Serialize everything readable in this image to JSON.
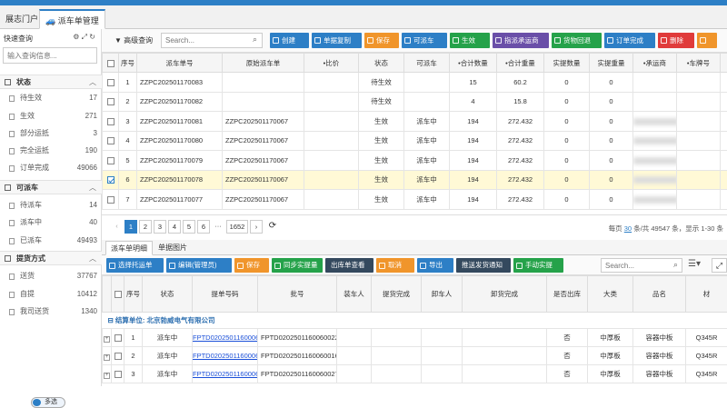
{
  "tabs": [
    {
      "label": "展志门户"
    },
    {
      "label": "派车单管理"
    }
  ],
  "sidebar": {
    "title": "快速查询",
    "search_placeholder": "输入查询信息...",
    "groups": [
      {
        "label": "状态",
        "items": [
          {
            "label": "待生效",
            "count": "17"
          },
          {
            "label": "生效",
            "count": "271"
          },
          {
            "label": "部分运抵",
            "count": "3"
          },
          {
            "label": "完全运抵",
            "count": "190"
          },
          {
            "label": "订单完成",
            "count": "49066"
          }
        ]
      },
      {
        "label": "可派车",
        "items": [
          {
            "label": "待派车",
            "count": "14"
          },
          {
            "label": "派车中",
            "count": "40"
          },
          {
            "label": "已派车",
            "count": "49493"
          }
        ]
      },
      {
        "label": "提货方式",
        "items": [
          {
            "label": "送货",
            "count": "37767"
          },
          {
            "label": "自提",
            "count": "10412"
          },
          {
            "label": "我司送货",
            "count": "1340"
          }
        ]
      }
    ],
    "toggle_label": "多选"
  },
  "toolbar": {
    "adv_query": "高级查询",
    "search_placeholder": "Search...",
    "buttons": [
      {
        "label": "创建",
        "color": "#2d7fc6"
      },
      {
        "label": "单据复制",
        "color": "#2d7fc6"
      },
      {
        "label": "保存",
        "color": "#f0952b"
      },
      {
        "label": "可派车",
        "color": "#2d7fc6"
      },
      {
        "label": "生效",
        "color": "#25a24a"
      },
      {
        "label": "指派承运商",
        "color": "#6a4fa8"
      },
      {
        "label": "货物回退",
        "color": "#25a24a"
      },
      {
        "label": "订单完成",
        "color": "#2d7fc6"
      },
      {
        "label": "删除",
        "color": "#e03b3b"
      },
      {
        "label": "",
        "color": "#f0952b"
      }
    ]
  },
  "grid": {
    "columns": [
      "",
      "序号",
      "派车单号",
      "原始派车单",
      "•比价",
      "状态",
      "可派车",
      "•合计数量",
      "•合计重量",
      "实提数量",
      "实提重量",
      "•承运商",
      "•车牌号",
      ""
    ],
    "rows": [
      {
        "no": "1",
        "code": "ZZPC202501170083",
        "orig": "",
        "state": "待生效",
        "dispatch": "",
        "qty": "15",
        "weight": "60.2",
        "aq": "0",
        "aw": "0",
        "carrier_blurred": false,
        "selected": false
      },
      {
        "no": "2",
        "code": "ZZPC202501170082",
        "orig": "",
        "state": "待生效",
        "dispatch": "",
        "qty": "4",
        "weight": "15.8",
        "aq": "0",
        "aw": "0",
        "carrier_blurred": false,
        "selected": false
      },
      {
        "no": "3",
        "code": "ZZPC202501170081",
        "orig": "ZZPC202501170067",
        "state": "生效",
        "dispatch": "派车中",
        "qty": "194",
        "weight": "272.432",
        "aq": "0",
        "aw": "0",
        "carrier_blurred": true,
        "selected": false
      },
      {
        "no": "4",
        "code": "ZZPC202501170080",
        "orig": "ZZPC202501170067",
        "state": "生效",
        "dispatch": "派车中",
        "qty": "194",
        "weight": "272.432",
        "aq": "0",
        "aw": "0",
        "carrier_blurred": true,
        "selected": false
      },
      {
        "no": "5",
        "code": "ZZPC202501170079",
        "orig": "ZZPC202501170067",
        "state": "生效",
        "dispatch": "派车中",
        "qty": "194",
        "weight": "272.432",
        "aq": "0",
        "aw": "0",
        "carrier_blurred": true,
        "selected": false
      },
      {
        "no": "6",
        "code": "ZZPC202501170078",
        "orig": "ZZPC202501170067",
        "state": "生效",
        "dispatch": "派车中",
        "qty": "194",
        "weight": "272.432",
        "aq": "0",
        "aw": "0",
        "carrier_blurred": true,
        "selected": true
      },
      {
        "no": "7",
        "code": "ZZPC202501170077",
        "orig": "ZZPC202501170067",
        "state": "生效",
        "dispatch": "派车中",
        "qty": "194",
        "weight": "272.432",
        "aq": "0",
        "aw": "0",
        "carrier_blurred": true,
        "selected": false
      }
    ]
  },
  "pager": {
    "pages": [
      "1",
      "2",
      "3",
      "4",
      "5",
      "6",
      "···",
      "1652"
    ],
    "current": "1",
    "per_page_prefix": "每页",
    "per_page": "30",
    "summary": "条/共 49547 条，显示 1-30 条"
  },
  "detail_tabs": [
    {
      "label": "派车单明细"
    },
    {
      "label": "单据图片"
    }
  ],
  "detail_toolbar": {
    "buttons": [
      {
        "label": "选择托运单",
        "color": "#2d7fc6"
      },
      {
        "label": "编辑(管理员)",
        "color": "#2d7fc6"
      },
      {
        "label": "保存",
        "color": "#f0952b"
      },
      {
        "label": "同步实提量",
        "color": "#25a24a"
      },
      {
        "label": "出库单查看",
        "color": "#34495e"
      },
      {
        "label": "取消",
        "color": "#f0952b"
      },
      {
        "label": "导出",
        "color": "#2d7fc6"
      },
      {
        "label": "推送发货通知",
        "color": "#34495e"
      },
      {
        "label": "手动实提",
        "color": "#25a24a"
      }
    ],
    "search_placeholder": "Search..."
  },
  "detail_grid": {
    "columns": [
      "",
      "",
      "序号",
      "状态",
      "提单号码",
      "批号",
      "装车人",
      "提货完成",
      "卸车人",
      "卸货完成",
      "是否出库",
      "大类",
      "品名",
      "材"
    ],
    "group_label": "结算单位: 北京勃威电气有限公司",
    "rows": [
      {
        "no": "1",
        "state": "派车中",
        "bill": "FPTD0202501160006",
        "batch": "FPTD0202501160060022",
        "out": "否",
        "cat": "中厚板",
        "name": "容器中板",
        "mat": "Q345R"
      },
      {
        "no": "2",
        "state": "派车中",
        "bill": "FPTD0202501160006",
        "batch": "FPTD0202501160060016",
        "out": "否",
        "cat": "中厚板",
        "name": "容器中板",
        "mat": "Q345R"
      },
      {
        "no": "3",
        "state": "派车中",
        "bill": "FPTD0202501160006",
        "batch": "FPTD0202501160060027",
        "out": "否",
        "cat": "中厚板",
        "name": "容器中板",
        "mat": "Q345R"
      }
    ]
  }
}
